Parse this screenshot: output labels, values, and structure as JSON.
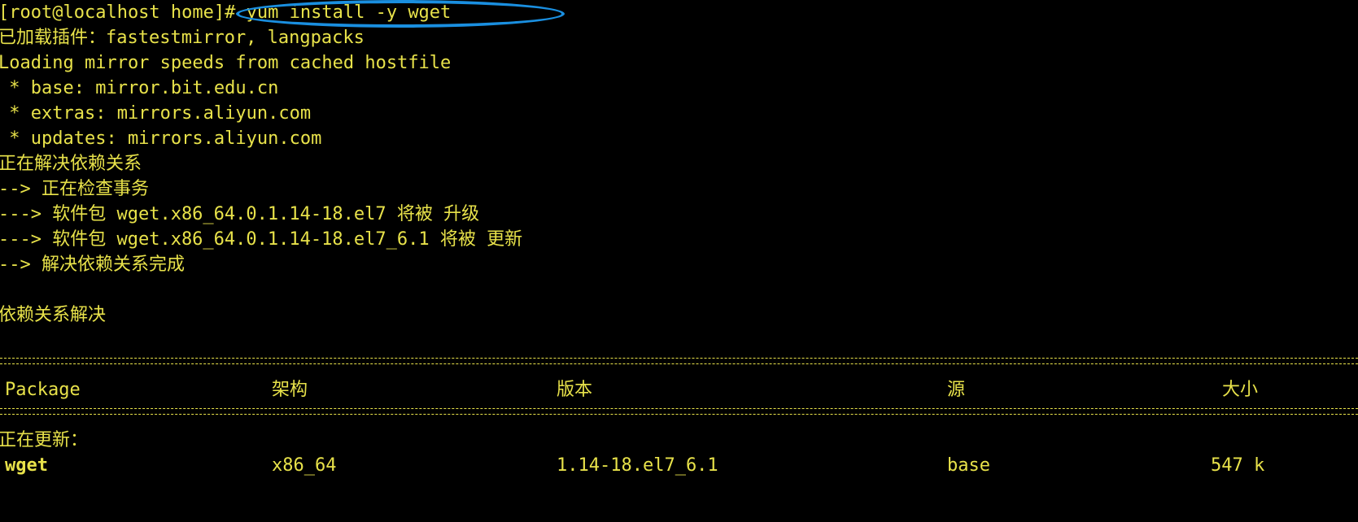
{
  "terminal": {
    "lines": [
      "[root@localhost home]# yum install -y wget",
      "已加载插件：fastestmirror, langpacks",
      "Loading mirror speeds from cached hostfile",
      " * base: mirror.bit.edu.cn",
      " * extras: mirrors.aliyun.com",
      " * updates: mirrors.aliyun.com",
      "正在解决依赖关系",
      "--> 正在检查事务",
      "---> 软件包 wget.x86_64.0.1.14-18.el7 将被 升级",
      "---> 软件包 wget.x86_64.0.1.14-18.el7_6.1 将被 更新",
      "--> 解决依赖关系完成",
      "",
      "依赖关系解决"
    ],
    "table": {
      "headers": {
        "package": "Package",
        "arch": "架构",
        "version": "版本",
        "repo": "源",
        "size": "大小"
      },
      "section_label": "正在更新：",
      "row": {
        "package": "wget",
        "arch": "x86_64",
        "version": "1.14-18.el7_6.1",
        "repo": "base",
        "size": "547 k"
      }
    }
  },
  "colors": {
    "background": "#000000",
    "text": "#e8e24a",
    "annotation": "#1a8fe0"
  }
}
